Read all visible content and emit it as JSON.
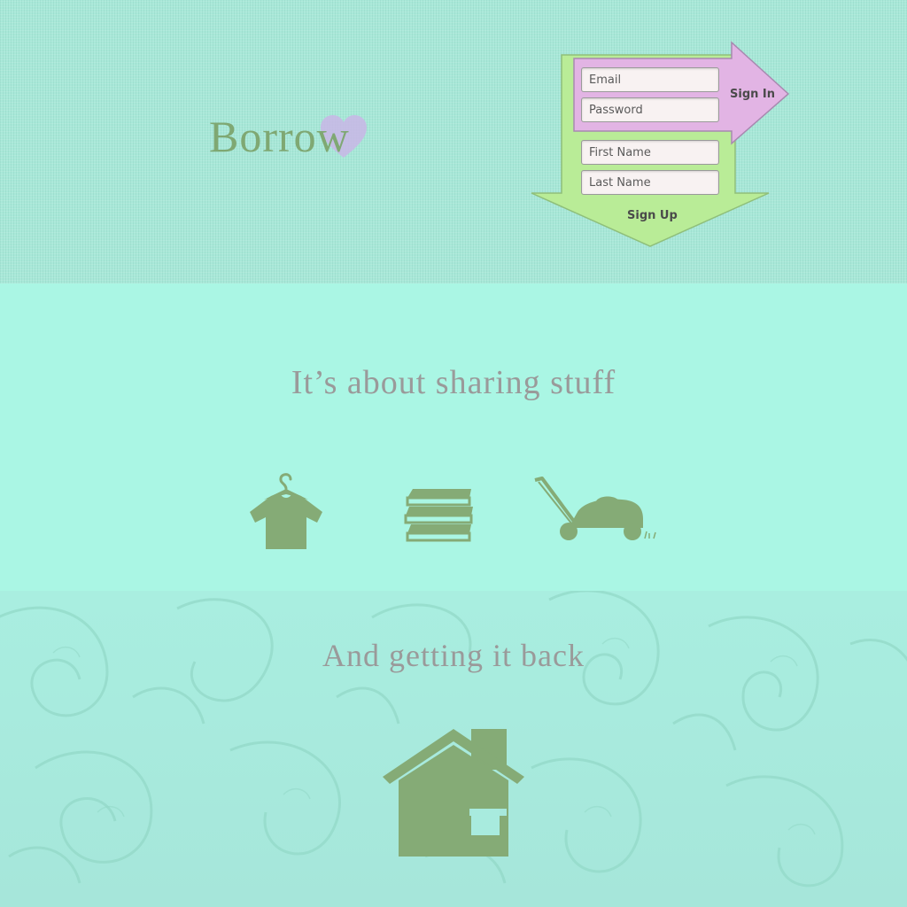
{
  "brand": {
    "name": "Borrow"
  },
  "signin": {
    "email_placeholder": "Email",
    "password_placeholder": "Password",
    "button_label": "Sign In"
  },
  "signup": {
    "first_name_placeholder": "First Name",
    "last_name_placeholder": "Last Name",
    "button_label": "Sign Up"
  },
  "sharing": {
    "headline": "It’s about sharing stuff",
    "icons": [
      "shirt-icon",
      "books-icon",
      "lawnmower-icon"
    ]
  },
  "returning": {
    "headline": "And getting it back",
    "icons": [
      "house-icon"
    ]
  },
  "colors": {
    "icon_green": "#85ab76",
    "signin_arrow": "#e2b4e4",
    "signup_arrow": "#b9ec97",
    "heading_gray": "#9a9a9a",
    "header_bg": "#a8e8d8",
    "middle_bg": "#aaf6e4",
    "bottom_bg": "#a9eee0"
  }
}
